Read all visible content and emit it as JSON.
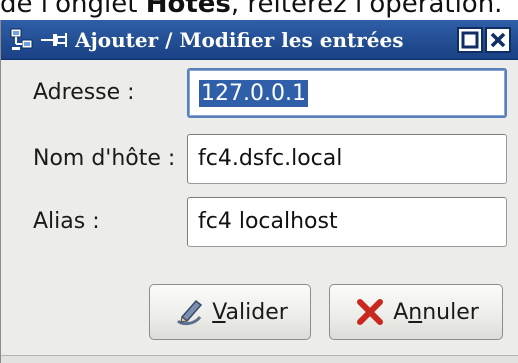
{
  "document": {
    "caption_prefix": "de l'onglet ",
    "caption_bold": "Hôtes",
    "caption_suffix": ", réitérez l'opération."
  },
  "window": {
    "title": "Ajouter / Modifier les entrées",
    "titlebar_color": "#234e93"
  },
  "form": {
    "address_label": "Adresse :",
    "address_value": "127.0.0.1",
    "hostname_label": "Nom d'hôte :",
    "hostname_value": "fc4.dsfc.local",
    "alias_label": "Alias :",
    "alias_value": "fc4 localhost"
  },
  "buttons": {
    "ok_mnemonic": "V",
    "ok_rest": "alider",
    "ok_icon": "pen-icon",
    "cancel_prefix": "A",
    "cancel_mnemonic": "n",
    "cancel_rest": "nuler",
    "cancel_icon": "red-x-icon"
  }
}
